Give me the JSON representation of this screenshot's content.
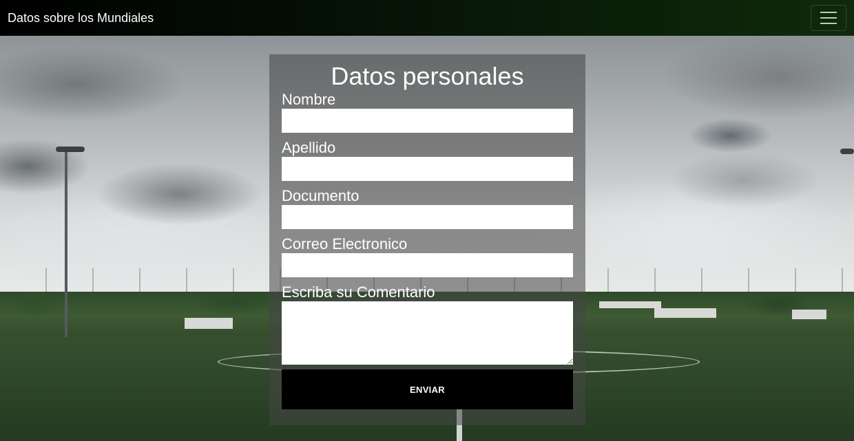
{
  "navbar": {
    "brand": "Datos sobre los Mundiales",
    "toggler_icon": "hamburger-menu-icon"
  },
  "form": {
    "title": "Datos personales",
    "fields": [
      {
        "label": "Nombre",
        "value": ""
      },
      {
        "label": "Apellido",
        "value": ""
      },
      {
        "label": "Documento",
        "value": ""
      },
      {
        "label": "Correo Electronico",
        "value": ""
      }
    ],
    "comment": {
      "label": "Escriba su Comentario",
      "value": ""
    },
    "submit_label": "ENVIAR"
  },
  "colors": {
    "navbar_bg": "#0f2a0a",
    "panel_bg": "rgba(70,70,70,0.55)",
    "button_bg": "#000000"
  }
}
